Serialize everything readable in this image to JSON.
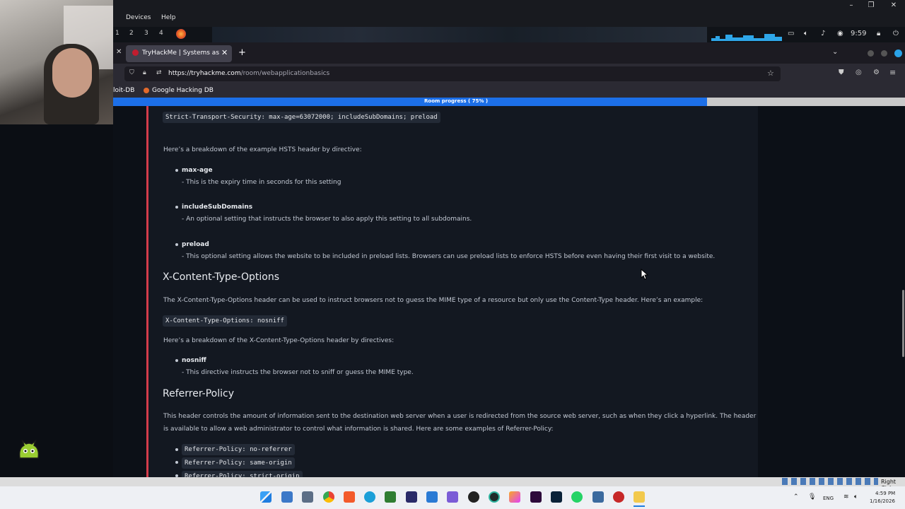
{
  "host_menu": {
    "devices": "Devices",
    "help": "Help"
  },
  "kali_panel": {
    "workspaces": [
      "1",
      "2",
      "3",
      "4"
    ],
    "clock": "9:59"
  },
  "browser": {
    "tab_title": "TryHackMe | Systems as",
    "url_host": "https://tryhackme.com",
    "url_path": "/room/webapplicationbasics",
    "bookmarks": [
      "loit-DB",
      "Google Hacking DB"
    ]
  },
  "progress": {
    "label": "Room progress ( 75% )",
    "value": 0.75
  },
  "content": {
    "hsts_code": "Strict-Transport-Security: max-age=63072000; includeSubDomains; preload",
    "hsts_intro": "Here’s a breakdown of the example HSTS header by directive:",
    "hsts_items": [
      {
        "name": "max-age",
        "desc": "- This is the expiry time in seconds for this setting"
      },
      {
        "name": "includeSubDomains",
        "desc": "- An optional setting that instructs the browser to also apply this setting to all subdomains."
      },
      {
        "name": "preload",
        "desc": "- This optional setting allows the website to be included in preload lists. Browsers can use preload lists to enforce HSTS before even having their first visit to a website."
      }
    ],
    "xcto_heading": "X-Content-Type-Options",
    "xcto_para": "The X-Content-Type-Options header can be used to instruct browsers not to guess the MIME type of a resource but only use the Content-Type header. Here’s an example:",
    "xcto_code": "X-Content-Type-Options: nosniff",
    "xcto_intro": "Here’s a breakdown of the X-Content-Type-Options header by directives:",
    "xcto_item_name": "nosniff",
    "xcto_item_desc": "- This directive instructs the browser not to sniff or guess the MIME type.",
    "ref_heading": "Referrer-Policy",
    "ref_para_1": "This header controls the amount of information sent to the destination web server when a user is redirected from the source web server, such as when they click a hyperlink. The header",
    "ref_para_2": "is available to allow a web administrator to control what information is shared.  Here are some examples of Referrer-Policy:",
    "ref_codes": [
      "Referrer-Policy: no-referrer",
      "Referrer-Policy: same-origin",
      "Referrer-Policy: strict-origin"
    ]
  },
  "vm_status": {
    "host_key": "Right Ctrl"
  },
  "windows_tray": {
    "lang": "ENG",
    "time": "4:59 PM",
    "date": "1/16/2026"
  }
}
